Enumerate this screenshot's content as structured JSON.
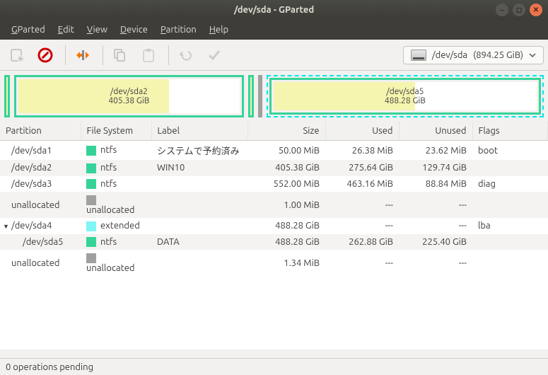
{
  "window": {
    "title": "/dev/sda - GParted"
  },
  "menu": {
    "gparted": "GParted",
    "edit": "Edit",
    "view": "View",
    "device": "Device",
    "partition": "Partition",
    "help": "Help"
  },
  "device_selector": {
    "device": "/dev/sda",
    "size": "(894.25 GiB)"
  },
  "disk_map": {
    "left": {
      "title": "/dev/sda2",
      "size": "405.38 GiB"
    },
    "right": {
      "title": "/dev/sda5",
      "size": "488.28 GiB"
    }
  },
  "columns": {
    "partition": "Partition",
    "filesystem": "File System",
    "label": "Label",
    "size": "Size",
    "used": "Used",
    "unused": "Unused",
    "flags": "Flags"
  },
  "colors": {
    "ntfs": "#36d399",
    "unallocated": "#a0a0a0",
    "extended": "#7ef6f6"
  },
  "rows": [
    {
      "partition": "/dev/sda1",
      "fs": "ntfs",
      "fscolor": "ntfs",
      "label": "システムで予約済み",
      "size": "50.00 MiB",
      "used": "26.38 MiB",
      "unused": "23.62 MiB",
      "flags": "boot",
      "indent": 1,
      "alt": false
    },
    {
      "partition": "/dev/sda2",
      "fs": "ntfs",
      "fscolor": "ntfs",
      "label": "WIN10",
      "size": "405.38 GiB",
      "used": "275.64 GiB",
      "unused": "129.74 GiB",
      "flags": "",
      "indent": 1,
      "alt": true
    },
    {
      "partition": "/dev/sda3",
      "fs": "ntfs",
      "fscolor": "ntfs",
      "label": "",
      "size": "552.00 MiB",
      "used": "463.16 MiB",
      "unused": "88.84 MiB",
      "flags": "diag",
      "indent": 1,
      "alt": false
    },
    {
      "partition": "unallocated",
      "fs": "unallocated",
      "fscolor": "unallocated",
      "label": "",
      "size": "1.00 MiB",
      "used": "---",
      "unused": "---",
      "flags": "",
      "indent": 1,
      "alt": true
    },
    {
      "partition": "/dev/sda4",
      "fs": "extended",
      "fscolor": "extended",
      "label": "",
      "size": "488.28 GiB",
      "used": "---",
      "unused": "---",
      "flags": "lba",
      "indent": 0,
      "alt": false,
      "expandable": true
    },
    {
      "partition": "/dev/sda5",
      "fs": "ntfs",
      "fscolor": "ntfs",
      "label": "DATA",
      "size": "488.28 GiB",
      "used": "262.88 GiB",
      "unused": "225.40 GiB",
      "flags": "",
      "indent": 2,
      "alt": true
    },
    {
      "partition": "unallocated",
      "fs": "unallocated",
      "fscolor": "unallocated",
      "label": "",
      "size": "1.34 MiB",
      "used": "---",
      "unused": "---",
      "flags": "",
      "indent": 1,
      "alt": false
    }
  ],
  "status": {
    "text": "0 operations pending"
  }
}
